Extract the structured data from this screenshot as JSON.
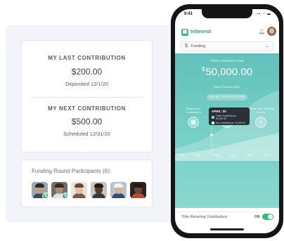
{
  "contribution_card": {
    "last_title": "MY LAST CONTRIBUTION",
    "last_amount": "$200.00",
    "last_date": "Deposited 12/1/20",
    "next_title": "MY NEXT CONTRIBUTION",
    "next_amount": "$500.00",
    "next_date": "Scheduled 12/31/20"
  },
  "participants_card": {
    "title": "Funding Round Participants (6):",
    "coin_symbol": "$",
    "participants": [
      {
        "skin": "#c99a7a",
        "hair": "#2a2a2a",
        "shirt": "#3b4a5c",
        "bg": "#9aa8b5"
      },
      {
        "skin": "#b58a6a",
        "hair": "#3a2a20",
        "shirt": "#dfe3e8",
        "bg": "#6d6f6a"
      },
      {
        "skin": "#e2bfa5",
        "hair": "#6a4a30",
        "shirt": "#7a5c4a",
        "bg": "#e9e4de"
      },
      {
        "skin": "#5b3a28",
        "hair": "#1a1a1a",
        "shirt": "#3a3a3a",
        "bg": "#c9c4bd"
      },
      {
        "skin": "#d9b08f",
        "hair": "#f2f2f2",
        "shirt": "#2d4f7a",
        "bg": "#b7c3cf"
      },
      {
        "skin": "#6e4a34",
        "hair": "#1f1a17",
        "shirt": "#c24a2a",
        "bg": "#2c2420"
      }
    ]
  },
  "phone": {
    "status_time": "9:41",
    "app_name": "tribevest",
    "account_select": "Funding",
    "balance_caption": "Tribe's Investment Fund",
    "balance": "50,000.00",
    "balance_currency": "$",
    "balance_updated": "Since February 2020",
    "primary_action": "SEE ALL CONTRIBUTIONS",
    "actions": [
      {
        "label": "Schedule a Contribution",
        "icon": "calendar-icon",
        "glyph": "▦"
      },
      {
        "label": "My Recurring Contributions",
        "icon": "refresh-icon",
        "glyph": "⇄"
      },
      {
        "label": "Create New Funding Round",
        "icon": "plus-icon",
        "glyph": "+"
      }
    ],
    "tooltip": {
      "date": "APRIL '20",
      "row1": "Tribe Contributions: 50,000.00",
      "row2": "My Contributions: 11,500.00"
    },
    "x_ticks": [
      "JAN",
      "FEB",
      "MAR",
      "APR",
      "MAY",
      "JUN"
    ],
    "toggle_label": "Tribe Recurring Contributions",
    "toggle_state": "ON"
  },
  "colors": {
    "brand_green": "#3fb68b",
    "teal": "#6fc9c1",
    "toggle_on": "#3cb878"
  }
}
